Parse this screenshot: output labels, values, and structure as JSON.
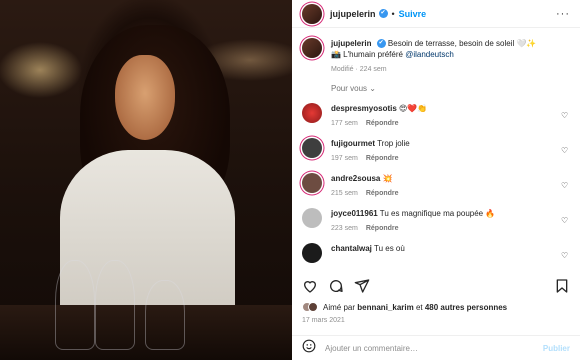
{
  "post": {
    "username": "jujupelerin",
    "follow_label": "Suivre",
    "caption": "Besoin de terrasse, besoin de soleil 🤍✨",
    "caption_line2": "📸 L'humain préféré",
    "caption_mention": "@ilandeutsch",
    "caption_meta": "Modifié · 224 sem",
    "pour_vous": "Pour vous",
    "likes_label_prefix": "Aimé par",
    "likes_user": "bennani_karim",
    "likes_suffix": "et",
    "likes_count": "480 autres personnes",
    "date": "17 mars 2021",
    "comment_placeholder": "Ajouter un commentaire…",
    "publish_label": "Publier"
  },
  "comments": [
    {
      "user": "despresmyosotis",
      "text": "😍❤️👏",
      "age": "177 sem",
      "reply": "Répondre"
    },
    {
      "user": "fujigourmet",
      "text": "Trop jolie",
      "age": "197 sem",
      "reply": "Répondre"
    },
    {
      "user": "andre2sousa",
      "text": "💥",
      "age": "215 sem",
      "reply": "Répondre"
    },
    {
      "user": "joyce011961",
      "text": "Tu es magnifique ma poupée 🔥",
      "age": "223 sem",
      "reply": "Répondre"
    },
    {
      "user": "chantalwaj",
      "text": "Tu es où",
      "age": "",
      "reply": ""
    }
  ],
  "colors": {
    "accent": "#0095f6",
    "verified": "#3897f0",
    "story_ring": "#d62976"
  }
}
